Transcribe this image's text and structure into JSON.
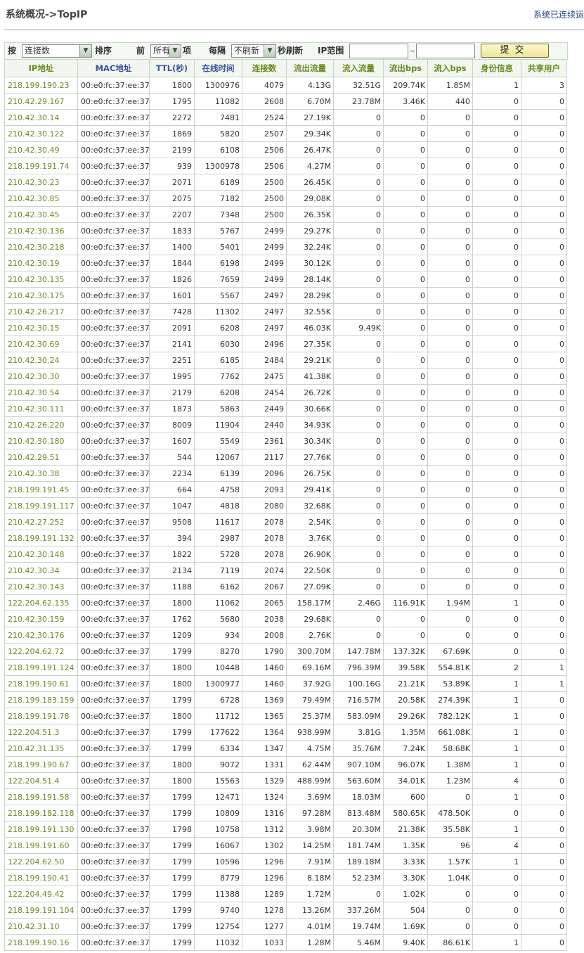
{
  "header": {
    "title": "系统概况->TopIP",
    "status": "系统已连续运"
  },
  "toolbar": {
    "by_label": "按",
    "sort_select": "连接数",
    "sort_label": "排序",
    "top_label": "前",
    "count_select": "所有",
    "item_label": "项",
    "every_label": "每隔",
    "refresh_select": "不刷新",
    "seconds_refresh_label": "秒刷新",
    "ip_range_label": "IP范围",
    "ip_from_value": "",
    "tilde": "~",
    "ip_to_value": "",
    "submit_label": "提交"
  },
  "table": {
    "columns": [
      "IP地址",
      "MAC地址",
      "TTL(秒)",
      "在线时间",
      "连接数",
      "流出流量",
      "流入流量",
      "流出bps",
      "流入bps",
      "身份信息",
      "共享用户"
    ],
    "rows": [
      [
        "218.199.190.23",
        "00:e0:fc:37:ee:37",
        "1800",
        "1300976",
        "4079",
        "4.13G",
        "32.51G",
        "209.74K",
        "1.85M",
        "1",
        "3"
      ],
      [
        "210.42.29.167",
        "00:e0:fc:37:ee:37",
        "1795",
        "11082",
        "2608",
        "6.70M",
        "23.78M",
        "3.46K",
        "440",
        "0",
        "0"
      ],
      [
        "210.42.30.14",
        "00:e0:fc:37:ee:37",
        "2272",
        "7481",
        "2524",
        "27.19K",
        "0",
        "0",
        "0",
        "0",
        "0"
      ],
      [
        "210.42.30.122",
        "00:e0:fc:37:ee:37",
        "1869",
        "5820",
        "2507",
        "29.34K",
        "0",
        "0",
        "0",
        "0",
        "0"
      ],
      [
        "210.42.30.49",
        "00:e0:fc:37:ee:37",
        "2199",
        "6108",
        "2506",
        "26.47K",
        "0",
        "0",
        "0",
        "0",
        "0"
      ],
      [
        "218.199.191.74",
        "00:e0:fc:37:ee:37",
        "939",
        "1300978",
        "2506",
        "4.27M",
        "0",
        "0",
        "0",
        "0",
        "0"
      ],
      [
        "210.42.30.23",
        "00:e0:fc:37:ee:37",
        "2071",
        "6189",
        "2500",
        "26.45K",
        "0",
        "0",
        "0",
        "0",
        "0"
      ],
      [
        "210.42.30.85",
        "00:e0:fc:37:ee:37",
        "2075",
        "7182",
        "2500",
        "29.08K",
        "0",
        "0",
        "0",
        "0",
        "0"
      ],
      [
        "210.42.30.45",
        "00:e0:fc:37:ee:37",
        "2207",
        "7348",
        "2500",
        "26.35K",
        "0",
        "0",
        "0",
        "0",
        "0"
      ],
      [
        "210.42.30.136",
        "00:e0:fc:37:ee:37",
        "1833",
        "5767",
        "2499",
        "29.27K",
        "0",
        "0",
        "0",
        "0",
        "0"
      ],
      [
        "210.42.30.218",
        "00:e0:fc:37:ee:37",
        "1400",
        "5401",
        "2499",
        "32.24K",
        "0",
        "0",
        "0",
        "0",
        "0"
      ],
      [
        "210.42.30.19",
        "00:e0:fc:37:ee:37",
        "1844",
        "6198",
        "2499",
        "30.12K",
        "0",
        "0",
        "0",
        "0",
        "0"
      ],
      [
        "210.42.30.135",
        "00:e0:fc:37:ee:37",
        "1826",
        "7659",
        "2499",
        "28.14K",
        "0",
        "0",
        "0",
        "0",
        "0"
      ],
      [
        "210.42.30.175",
        "00:e0:fc:37:ee:37",
        "1601",
        "5567",
        "2497",
        "28.29K",
        "0",
        "0",
        "0",
        "0",
        "0"
      ],
      [
        "210.42.26.217",
        "00:e0:fc:37:ee:37",
        "7428",
        "11302",
        "2497",
        "32.55K",
        "0",
        "0",
        "0",
        "0",
        "0"
      ],
      [
        "210.42.30.15",
        "00:e0:fc:37:ee:37",
        "2091",
        "6208",
        "2497",
        "46.03K",
        "9.49K",
        "0",
        "0",
        "0",
        "0"
      ],
      [
        "210.42.30.69",
        "00:e0:fc:37:ee:37",
        "2141",
        "6030",
        "2496",
        "27.35K",
        "0",
        "0",
        "0",
        "0",
        "0"
      ],
      [
        "210.42.30.24",
        "00:e0:fc:37:ee:37",
        "2251",
        "6185",
        "2484",
        "29.21K",
        "0",
        "0",
        "0",
        "0",
        "0"
      ],
      [
        "210.42.30.30",
        "00:e0:fc:37:ee:37",
        "1995",
        "7762",
        "2475",
        "41.38K",
        "0",
        "0",
        "0",
        "0",
        "0"
      ],
      [
        "210.42.30.54",
        "00:e0:fc:37:ee:37",
        "2179",
        "6208",
        "2454",
        "26.72K",
        "0",
        "0",
        "0",
        "0",
        "0"
      ],
      [
        "210.42.30.111",
        "00:e0:fc:37:ee:37",
        "1873",
        "5863",
        "2449",
        "30.66K",
        "0",
        "0",
        "0",
        "0",
        "0"
      ],
      [
        "210.42.26.220",
        "00:e0:fc:37:ee:37",
        "8009",
        "11904",
        "2440",
        "34.93K",
        "0",
        "0",
        "0",
        "0",
        "0"
      ],
      [
        "210.42.30.180",
        "00:e0:fc:37:ee:37",
        "1607",
        "5549",
        "2361",
        "30.34K",
        "0",
        "0",
        "0",
        "0",
        "0"
      ],
      [
        "210.42.29.51",
        "00:e0:fc:37:ee:37",
        "544",
        "12067",
        "2117",
        "27.76K",
        "0",
        "0",
        "0",
        "0",
        "0"
      ],
      [
        "210.42.30.38",
        "00:e0:fc:37:ee:37",
        "2234",
        "6139",
        "2096",
        "26.75K",
        "0",
        "0",
        "0",
        "0",
        "0"
      ],
      [
        "218.199.191.45",
        "00:e0:fc:37:ee:37",
        "664",
        "4758",
        "2093",
        "29.41K",
        "0",
        "0",
        "0",
        "0",
        "0"
      ],
      [
        "218.199.191.117",
        "00:e0:fc:37:ee:37",
        "1047",
        "4818",
        "2080",
        "32.68K",
        "0",
        "0",
        "0",
        "0",
        "0"
      ],
      [
        "210.42.27.252",
        "00:e0:fc:37:ee:37",
        "9508",
        "11617",
        "2078",
        "2.54K",
        "0",
        "0",
        "0",
        "0",
        "0"
      ],
      [
        "218.199.191.132",
        "00:e0:fc:37:ee:37",
        "394",
        "2987",
        "2078",
        "3.76K",
        "0",
        "0",
        "0",
        "0",
        "0"
      ],
      [
        "210.42.30.148",
        "00:e0:fc:37:ee:37",
        "1822",
        "5728",
        "2078",
        "26.90K",
        "0",
        "0",
        "0",
        "0",
        "0"
      ],
      [
        "210.42.30.34",
        "00:e0:fc:37:ee:37",
        "2134",
        "7119",
        "2074",
        "22.50K",
        "0",
        "0",
        "0",
        "0",
        "0"
      ],
      [
        "210.42.30.143",
        "00:e0:fc:37:ee:37",
        "1188",
        "6162",
        "2067",
        "27.09K",
        "0",
        "0",
        "0",
        "0",
        "0"
      ],
      [
        "122.204.62.135",
        "00:e0:fc:37:ee:37",
        "1800",
        "11062",
        "2065",
        "158.17M",
        "2.46G",
        "116.91K",
        "1.94M",
        "1",
        "0"
      ],
      [
        "210.42.30.159",
        "00:e0:fc:37:ee:37",
        "1762",
        "5680",
        "2038",
        "29.68K",
        "0",
        "0",
        "0",
        "0",
        "0"
      ],
      [
        "210.42.30.176",
        "00:e0:fc:37:ee:37",
        "1209",
        "934",
        "2008",
        "2.76K",
        "0",
        "0",
        "0",
        "0",
        "0"
      ],
      [
        "122.204.62.72",
        "00:e0:fc:37:ee:37",
        "1799",
        "8270",
        "1790",
        "300.70M",
        "147.78M",
        "137.32K",
        "67.69K",
        "0",
        "0"
      ],
      [
        "218.199.191.124",
        "00:e0:fc:37:ee:37",
        "1800",
        "10448",
        "1460",
        "69.16M",
        "796.39M",
        "39.58K",
        "554.81K",
        "2",
        "1"
      ],
      [
        "218.199.190.61",
        "00:e0:fc:37:ee:37",
        "1800",
        "1300977",
        "1460",
        "37.92G",
        "100.16G",
        "21.21K",
        "53.89K",
        "1",
        "1"
      ],
      [
        "218.199.183.159",
        "00:e0:fc:37:ee:37",
        "1799",
        "6728",
        "1369",
        "79.49M",
        "716.57M",
        "20.58K",
        "274.39K",
        "1",
        "0"
      ],
      [
        "218.199.191.78",
        "00:e0:fc:37:ee:37",
        "1800",
        "11712",
        "1365",
        "25.37M",
        "583.09M",
        "29.26K",
        "782.12K",
        "1",
        "0"
      ],
      [
        "122.204.51.3",
        "00:e0:fc:37:ee:37",
        "1799",
        "177622",
        "1364",
        "938.99M",
        "3.81G",
        "1.35M",
        "661.08K",
        "1",
        "0"
      ],
      [
        "210.42.31.135",
        "00:e0:fc:37:ee:37",
        "1799",
        "6334",
        "1347",
        "4.75M",
        "35.76M",
        "7.24K",
        "58.68K",
        "1",
        "0"
      ],
      [
        "218.199.190.67",
        "00:e0:fc:37:ee:37",
        "1800",
        "9072",
        "1331",
        "62.44M",
        "907.10M",
        "96.07K",
        "1.38M",
        "1",
        "0"
      ],
      [
        "122.204.51.4",
        "00:e0:fc:37:ee:37",
        "1800",
        "15563",
        "1329",
        "488.99M",
        "563.60M",
        "34.01K",
        "1.23M",
        "4",
        "0"
      ],
      [
        "218.199.191.58",
        "00:e0:fc:37:ee:37",
        "1799",
        "12471",
        "1324",
        "3.69M",
        "18.03M",
        "600",
        "0",
        "1",
        "0"
      ],
      [
        "218.199.182.118",
        "00:e0:fc:37:ee:37",
        "1799",
        "10809",
        "1316",
        "97.28M",
        "813.48M",
        "580.65K",
        "478.50K",
        "0",
        "0"
      ],
      [
        "218.199.191.130",
        "00:e0:fc:37:ee:37",
        "1798",
        "10758",
        "1312",
        "3.98M",
        "20.30M",
        "21.38K",
        "35.58K",
        "1",
        "0"
      ],
      [
        "218.199.191.60",
        "00:e0:fc:37:ee:37",
        "1799",
        "16067",
        "1302",
        "14.25M",
        "181.74M",
        "1.35K",
        "96",
        "4",
        "0"
      ],
      [
        "122.204.62.50",
        "00:e0:fc:37:ee:37",
        "1799",
        "10596",
        "1296",
        "7.91M",
        "189.18M",
        "3.33K",
        "1.57K",
        "1",
        "0"
      ],
      [
        "218.199.190.41",
        "00:e0:fc:37:ee:37",
        "1799",
        "8779",
        "1296",
        "8.18M",
        "52.23M",
        "3.30K",
        "1.04K",
        "0",
        "0"
      ],
      [
        "122.204.49.42",
        "00:e0:fc:37:ee:37",
        "1799",
        "11388",
        "1289",
        "1.72M",
        "0",
        "1.02K",
        "0",
        "0",
        "0"
      ],
      [
        "218.199.191.104",
        "00:e0:fc:37:ee:37",
        "1799",
        "9740",
        "1278",
        "13.26M",
        "337.26M",
        "504",
        "0",
        "0",
        "0"
      ],
      [
        "210.42.31.10",
        "00:e0:fc:37:ee:37",
        "1799",
        "12754",
        "1277",
        "4.01M",
        "19.74M",
        "1.69K",
        "0",
        "0",
        "0"
      ],
      [
        "218.199.190.16",
        "00:e0:fc:37:ee:37",
        "1799",
        "11032",
        "1033",
        "1.28M",
        "5.46M",
        "9.40K",
        "86.61K",
        "1",
        "0"
      ]
    ]
  }
}
